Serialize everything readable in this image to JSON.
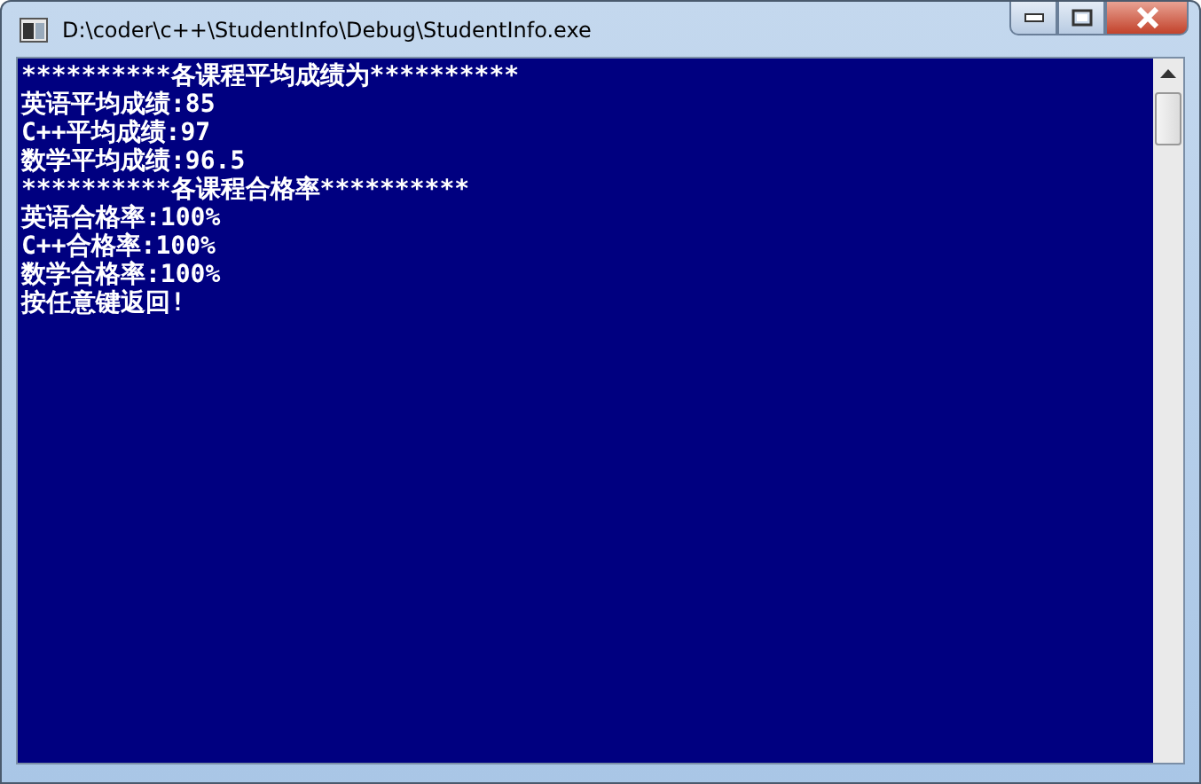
{
  "window": {
    "title": "D:\\coder\\c++\\StudentInfo\\Debug\\StudentInfo.exe"
  },
  "console": {
    "lines": [
      "**********各课程平均成绩为**********",
      "英语平均成绩:85",
      "C++平均成绩:97",
      "数学平均成绩:96.5",
      "**********各课程合格率**********",
      "英语合格率:100%",
      "C++合格率:100%",
      "数学合格率:100%",
      "按任意键返回!"
    ]
  }
}
